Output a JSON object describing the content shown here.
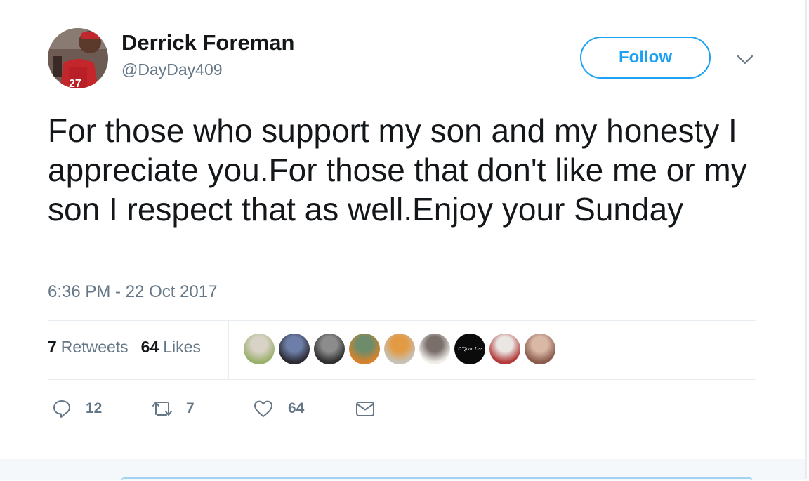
{
  "author": {
    "name": "Derrick Foreman",
    "handle": "@DayDay409"
  },
  "follow_label": "Follow",
  "tweet_text": "For those who support my son and my honesty I appreciate you.For those that don't like me or my son I respect that as well.Enjoy your Sunday",
  "timestamp": "6:36 PM - 22 Oct 2017",
  "stats": {
    "retweets_count": "7",
    "retweets_label": "Retweets",
    "likes_count": "64",
    "likes_label": "Likes"
  },
  "liker_avatars": [
    {
      "name": "liker-avatar-1",
      "colors": [
        "#9bb06d",
        "#d8d3c6"
      ]
    },
    {
      "name": "liker-avatar-2",
      "colors": [
        "#2c2a33",
        "#6d7fa8"
      ]
    },
    {
      "name": "liker-avatar-3",
      "colors": [
        "#2f2f2f",
        "#8c8c8c"
      ]
    },
    {
      "name": "liker-avatar-4",
      "colors": [
        "#d9822b",
        "#6d8c6a"
      ]
    },
    {
      "name": "liker-avatar-5",
      "colors": [
        "#c7c2b8",
        "#e39a45"
      ]
    },
    {
      "name": "liker-avatar-6",
      "colors": [
        "#f1eeea",
        "#7a6f6a"
      ]
    },
    {
      "name": "liker-avatar-7",
      "colors": [
        "#0b0b0b",
        "#1e1e1e"
      ],
      "label": "D'Quan Lee"
    },
    {
      "name": "liker-avatar-8",
      "colors": [
        "#b23a3a",
        "#e9e6e3"
      ]
    },
    {
      "name": "liker-avatar-9",
      "colors": [
        "#8a5a4a",
        "#d9b8a6"
      ]
    }
  ],
  "actions": {
    "reply_count": "12",
    "retweet_count": "7",
    "like_count": "64"
  },
  "icons": {
    "more": "chevron-down-icon",
    "reply": "reply-icon",
    "retweet": "retweet-icon",
    "like": "heart-icon",
    "dm": "envelope-icon"
  },
  "colors": {
    "accent": "#1da1f2",
    "text": "#14171a",
    "muted": "#657786",
    "divider": "#e6ecf0"
  }
}
